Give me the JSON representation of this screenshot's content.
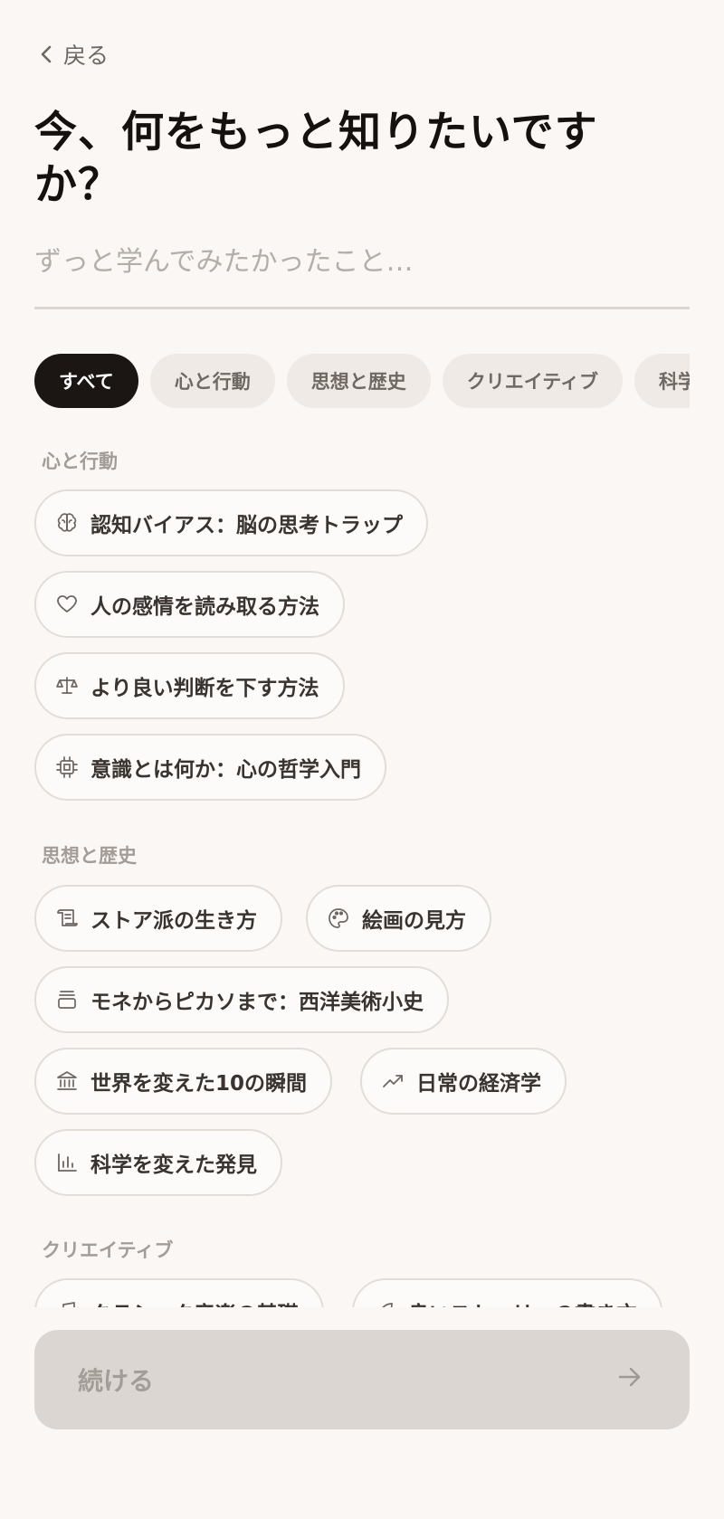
{
  "nav": {
    "back_label": "戻る"
  },
  "header": {
    "title_line1": "今、何をもっと知りたいです",
    "title_line2": "か？"
  },
  "search": {
    "placeholder": "ずっと学んでみたかったこと…",
    "value": ""
  },
  "tabs": [
    {
      "label": "すべて",
      "active": true
    },
    {
      "label": "心と行動",
      "active": false
    },
    {
      "label": "思想と歴史",
      "active": false
    },
    {
      "label": "クリエイティブ",
      "active": false
    },
    {
      "label": "科学",
      "active": false
    }
  ],
  "sections": {
    "mind": {
      "label": "心と行動",
      "items": [
        {
          "label": "認知バイアス：脳の思考トラップ",
          "icon": "brain-icon"
        },
        {
          "label": "人の感情を読み取る方法",
          "icon": "heart-icon"
        },
        {
          "label": "より良い判断を下す方法",
          "icon": "scale-icon"
        },
        {
          "label": "意識とは何か：心の哲学入門",
          "icon": "chip-icon"
        }
      ]
    },
    "history": {
      "label": "思想と歴史",
      "items": [
        {
          "label": "ストア派の生き方",
          "icon": "scroll-icon"
        },
        {
          "label": "絵画の見方",
          "icon": "palette-icon"
        },
        {
          "label": "モネからピカソまで：西洋美術小史",
          "icon": "frame-icon"
        },
        {
          "label": "世界を変えた10の瞬間",
          "icon": "landmark-icon"
        },
        {
          "label": "日常の経済学",
          "icon": "trend-up-icon"
        },
        {
          "label": "科学を変えた発見",
          "icon": "bar-chart-icon"
        }
      ]
    },
    "creative": {
      "label": "クリエイティブ",
      "items": [
        {
          "label": "クラシック音楽の基礎",
          "icon": "music-note-icon"
        },
        {
          "label": "良いストーリーの書き方",
          "icon": "feather-icon"
        }
      ]
    }
  },
  "footer": {
    "continue_label": "続ける"
  }
}
